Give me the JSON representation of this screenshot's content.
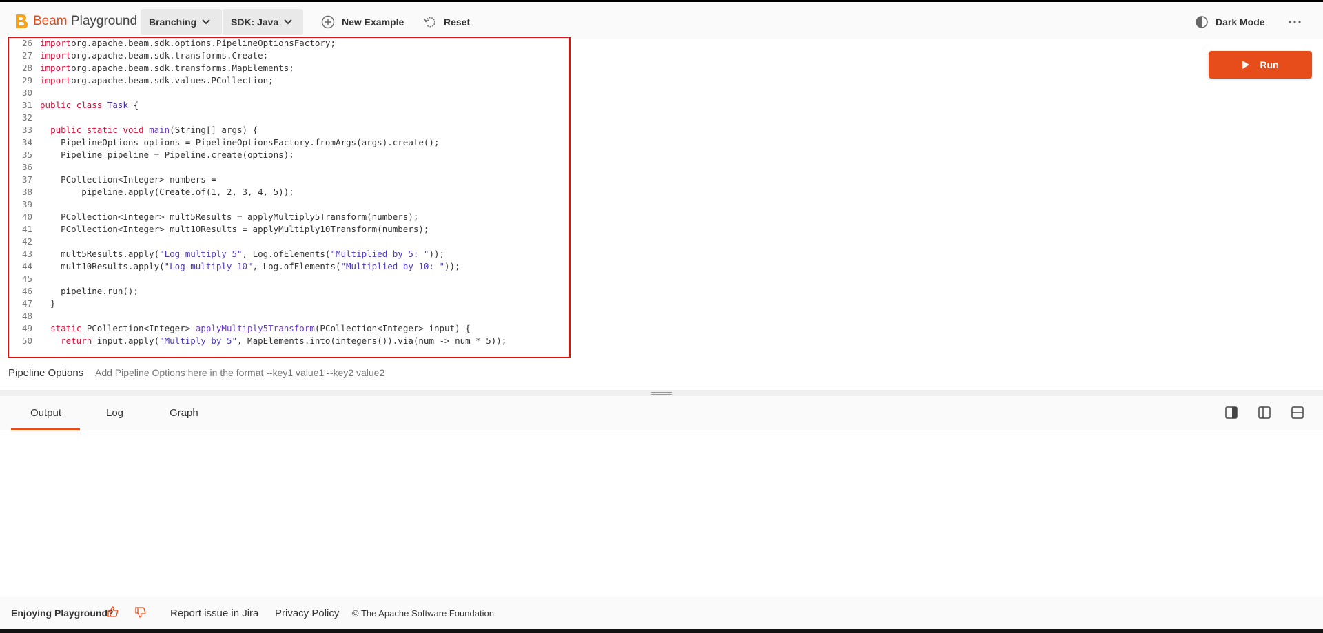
{
  "header": {
    "brand": "Beam",
    "product": "Playground",
    "example_dropdown": "Branching",
    "sdk_dropdown": "SDK: Java",
    "new_example": "New Example",
    "reset": "Reset",
    "dark_mode": "Dark Mode",
    "more_icon": "more-horizontal-icon"
  },
  "run_button": {
    "label": "Run"
  },
  "code": {
    "lines": [
      {
        "n": "26",
        "tokens": [
          [
            "kw",
            "import"
          ],
          [
            "",
            "org.apache.beam.sdk.options.PipelineOptionsFactory;"
          ]
        ]
      },
      {
        "n": "27",
        "tokens": [
          [
            "kw",
            "import"
          ],
          [
            "",
            "org.apache.beam.sdk.transforms.Create;"
          ]
        ]
      },
      {
        "n": "28",
        "tokens": [
          [
            "kw",
            "import"
          ],
          [
            "",
            "org.apache.beam.sdk.transforms.MapElements;"
          ]
        ]
      },
      {
        "n": "29",
        "tokens": [
          [
            "kw",
            "import"
          ],
          [
            "",
            "org.apache.beam.sdk.values.PCollection;"
          ]
        ]
      },
      {
        "n": "30",
        "tokens": []
      },
      {
        "n": "31",
        "tokens": [
          [
            "kw",
            "public class"
          ],
          [
            "",
            " "
          ],
          [
            "cls",
            "Task"
          ],
          [
            "",
            " {"
          ]
        ]
      },
      {
        "n": "32",
        "tokens": []
      },
      {
        "n": "33",
        "tokens": [
          [
            "",
            "  "
          ],
          [
            "kw",
            "public static void"
          ],
          [
            "",
            " "
          ],
          [
            "fn",
            "main"
          ],
          [
            "",
            "(String[] args) {"
          ]
        ]
      },
      {
        "n": "34",
        "tokens": [
          [
            "",
            "    PipelineOptions options = PipelineOptionsFactory.fromArgs(args).create();"
          ]
        ]
      },
      {
        "n": "35",
        "tokens": [
          [
            "",
            "    Pipeline pipeline = Pipeline.create(options);"
          ]
        ]
      },
      {
        "n": "36",
        "tokens": []
      },
      {
        "n": "37",
        "tokens": [
          [
            "",
            "    PCollection<Integer> numbers ="
          ]
        ]
      },
      {
        "n": "38",
        "tokens": [
          [
            "",
            "        pipeline.apply(Create.of(1, 2, 3, 4, 5));"
          ]
        ]
      },
      {
        "n": "39",
        "tokens": []
      },
      {
        "n": "40",
        "tokens": [
          [
            "",
            "    PCollection<Integer> mult5Results = applyMultiply5Transform(numbers);"
          ]
        ]
      },
      {
        "n": "41",
        "tokens": [
          [
            "",
            "    PCollection<Integer> mult10Results = applyMultiply10Transform(numbers);"
          ]
        ]
      },
      {
        "n": "42",
        "tokens": []
      },
      {
        "n": "43",
        "tokens": [
          [
            "",
            "    mult5Results.apply("
          ],
          [
            "str",
            "\"Log multiply 5\""
          ],
          [
            "",
            ", Log.ofElements("
          ],
          [
            "str",
            "\"Multiplied by 5: \""
          ],
          [
            "",
            "));"
          ]
        ]
      },
      {
        "n": "44",
        "tokens": [
          [
            "",
            "    mult10Results.apply("
          ],
          [
            "str",
            "\"Log multiply 10\""
          ],
          [
            "",
            ", Log.ofElements("
          ],
          [
            "str",
            "\"Multiplied by 10: \""
          ],
          [
            "",
            "));"
          ]
        ]
      },
      {
        "n": "45",
        "tokens": []
      },
      {
        "n": "46",
        "tokens": [
          [
            "",
            "    pipeline.run();"
          ]
        ]
      },
      {
        "n": "47",
        "tokens": [
          [
            "",
            "  }"
          ]
        ]
      },
      {
        "n": "48",
        "tokens": []
      },
      {
        "n": "49",
        "tokens": [
          [
            "",
            "  "
          ],
          [
            "kw",
            "static"
          ],
          [
            "",
            " PCollection<Integer> "
          ],
          [
            "fn",
            "applyMultiply5Transform"
          ],
          [
            "",
            "(PCollection<Integer> input) {"
          ]
        ]
      },
      {
        "n": "50",
        "tokens": [
          [
            "",
            "    "
          ],
          [
            "kw",
            "return"
          ],
          [
            "",
            " input.apply("
          ],
          [
            "str",
            "\"Multiply by 5\""
          ],
          [
            "",
            ", MapElements.into(integers()).via(num -> num * 5));"
          ]
        ]
      }
    ]
  },
  "pipeline_options": {
    "label": "Pipeline Options",
    "placeholder": "Add Pipeline Options here in the format --key1 value1 --key2 value2"
  },
  "output_tabs": [
    "Output",
    "Log",
    "Graph"
  ],
  "footer": {
    "enjoying": "Enjoying Playground?",
    "report": "Report issue in Jira",
    "privacy": "Privacy Policy",
    "copyright": "© The Apache Software Foundation"
  },
  "colors": {
    "accent": "#e74d1a",
    "keyword": "#d8123a",
    "class": "#4c2fb0",
    "string": "#4c3ab8"
  }
}
